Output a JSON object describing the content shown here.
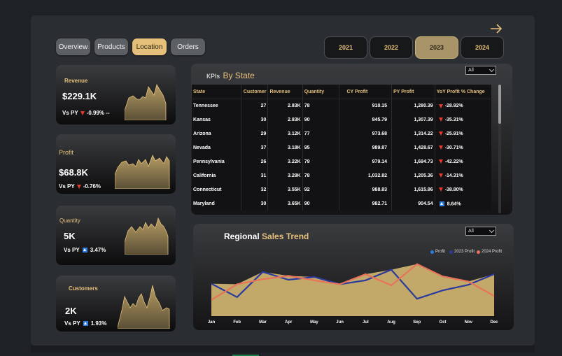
{
  "tabs": [
    "Overview",
    "Products",
    "Location",
    "Orders"
  ],
  "active_tab": "Location",
  "years": [
    "2021",
    "2022",
    "2023",
    "2024"
  ],
  "active_year": "2023",
  "cards": {
    "revenue": {
      "label": "Revenue",
      "value": "$229.1K",
      "vs_label": "Vs PY",
      "change": "-0.99% --",
      "direction": "down"
    },
    "profit": {
      "label": "Profit",
      "value": "$68.8K",
      "vs_label": "Vs PY",
      "change": "-0.76%",
      "direction": "down"
    },
    "quantity": {
      "label": "Quantity",
      "value": "5K",
      "vs_label": "Vs PY",
      "change": "3.47%",
      "direction": "up"
    },
    "customers": {
      "label": "Customers",
      "value": "2K",
      "vs_label": "Vs PY",
      "change": "1.93%",
      "direction": "up"
    }
  },
  "kpi_table": {
    "title_prefix": "KPIs",
    "title_main": "By State",
    "filter": "All",
    "columns": [
      "State",
      "Customer",
      "Revenue",
      "Quantity",
      "CY Profit",
      "PY Profit",
      "YoY Profit % Change"
    ],
    "rows": [
      [
        "Tennessee",
        "27",
        "2.83K",
        "78",
        "910.15",
        "1,280.39",
        "-28.92%",
        "down"
      ],
      [
        "Kansas",
        "30",
        "2.83K",
        "90",
        "845.79",
        "1,307.39",
        "-35.31%",
        "down"
      ],
      [
        "Arizona",
        "29",
        "3.12K",
        "77",
        "973.68",
        "1,314.22",
        "-25.91%",
        "down"
      ],
      [
        "Nevada",
        "37",
        "3.18K",
        "95",
        "989.87",
        "1,428.67",
        "-30.71%",
        "down"
      ],
      [
        "Pennsylvania",
        "26",
        "3.22K",
        "79",
        "979.14",
        "1,694.73",
        "-42.22%",
        "down"
      ],
      [
        "California",
        "31",
        "3.29K",
        "78",
        "1,032.82",
        "1,205.36",
        "-14.31%",
        "down"
      ],
      [
        "Connecticut",
        "32",
        "3.55K",
        "92",
        "988.83",
        "1,615.86",
        "-38.80%",
        "down"
      ],
      [
        "Maryland",
        "30",
        "3.65K",
        "90",
        "982.71",
        "904.54",
        "8.64%",
        "up"
      ]
    ]
  },
  "trend": {
    "title_main": "Regional",
    "title_accent": "Sales Trend",
    "filter": "All",
    "legend": [
      {
        "name": "Profit",
        "color": "#2d7be5"
      },
      {
        "name": "2023 Profit",
        "color": "#2b3a9e"
      },
      {
        "name": "2024 Profit",
        "color": "#e8735a"
      }
    ]
  },
  "colors": {
    "gold": "#e5c07b",
    "area_fill": "#c2a96a",
    "line_blue": "#2b3a9e",
    "line_orange": "#e8735a",
    "down": "#e23b2e",
    "up": "#2d7be5"
  },
  "chart_data": {
    "type": "line",
    "x": [
      "Jan",
      "Feb",
      "Mar",
      "Apr",
      "May",
      "Jun",
      "Jul",
      "Aug",
      "Sep",
      "Oct",
      "Nov",
      "Dec"
    ],
    "series": [
      {
        "name": "2023 Profit",
        "values": [
          0.58,
          0.34,
          0.79,
          0.65,
          0.7,
          0.57,
          0.64,
          0.83,
          0.31,
          0.46,
          0.56,
          0.75
        ]
      },
      {
        "name": "2024 Profit",
        "values": [
          0.29,
          0.57,
          0.66,
          0.72,
          0.64,
          0.57,
          0.75,
          0.55,
          0.93,
          0.71,
          0.62,
          0.36
        ]
      }
    ],
    "area_fill": "max of 2023 Profit and 2024 Profit",
    "ylim": [
      0,
      1
    ],
    "legend_position": "top-right",
    "grid": false,
    "yaxis": "unlabeled, hidden; values normalized 0-1"
  }
}
